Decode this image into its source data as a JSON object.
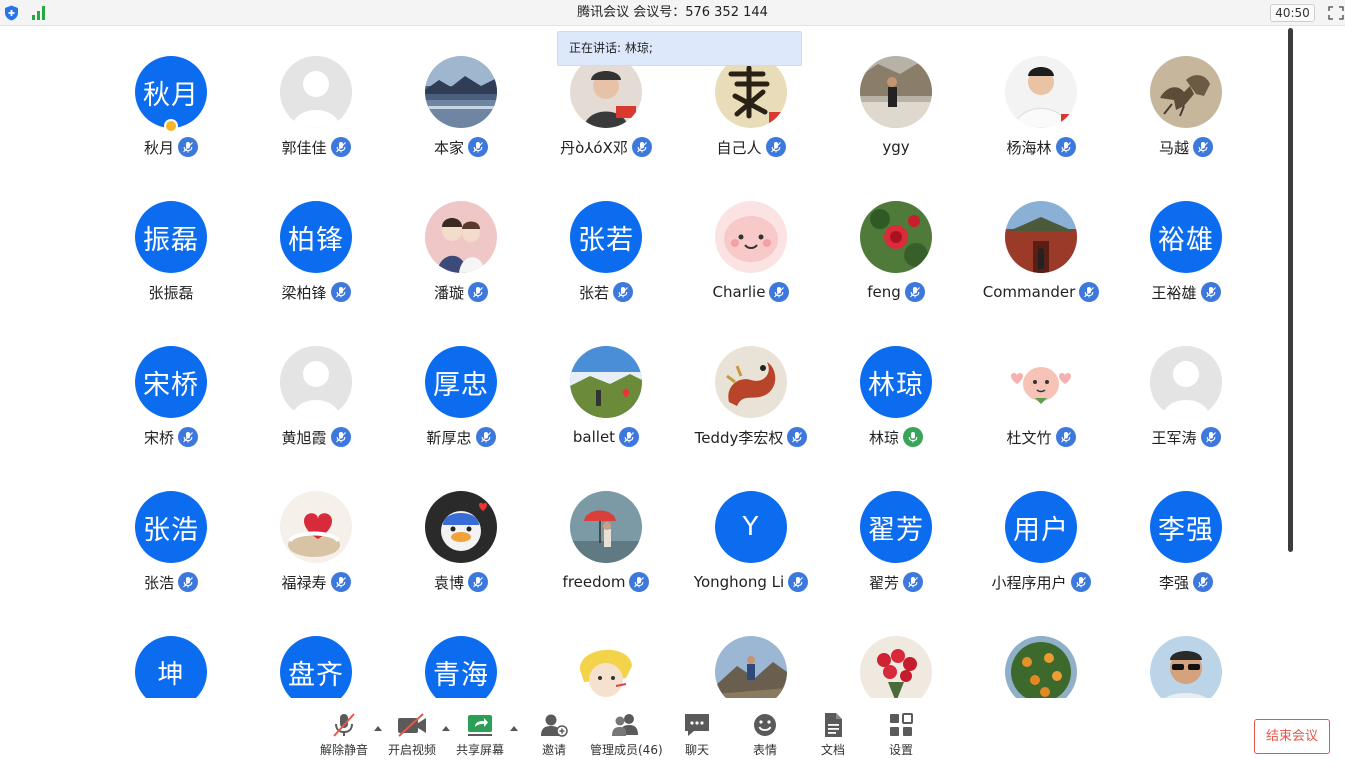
{
  "window": {
    "title": "腾讯会议 会议号：576 352 144",
    "timer": "40:50"
  },
  "speaking_banner": "正在讲话: 林琼;",
  "participants": [
    {
      "name": "秋月",
      "avatar_type": "text",
      "avatar_text": "秋月",
      "mic": "muted",
      "host": true
    },
    {
      "name": "郭佳佳",
      "avatar_type": "silhouette",
      "mic": "muted"
    },
    {
      "name": "本家",
      "avatar_type": "photo",
      "photo": "landscape-lake",
      "mic": "muted"
    },
    {
      "name": "丹ò⅄óX邓",
      "avatar_type": "photo",
      "photo": "person-cap",
      "mic": "muted"
    },
    {
      "name": "自己人",
      "avatar_type": "photo",
      "photo": "calligraphy",
      "mic": "muted"
    },
    {
      "name": "ygy",
      "avatar_type": "photo",
      "photo": "person-outdoor",
      "mic": "none"
    },
    {
      "name": "杨海林",
      "avatar_type": "photo",
      "photo": "person-portrait",
      "mic": "muted"
    },
    {
      "name": "马越",
      "avatar_type": "photo",
      "photo": "horses-painting",
      "mic": "muted"
    },
    {
      "name": "张振磊",
      "avatar_type": "text",
      "avatar_text": "振磊",
      "mic": "none"
    },
    {
      "name": "梁柏锋",
      "avatar_type": "text",
      "avatar_text": "柏锋",
      "mic": "muted"
    },
    {
      "name": "潘璇",
      "avatar_type": "photo",
      "photo": "cartoon-couple",
      "mic": "muted"
    },
    {
      "name": "张若",
      "avatar_type": "text",
      "avatar_text": "张若",
      "mic": "muted"
    },
    {
      "name": "Charlie",
      "avatar_type": "photo",
      "photo": "pink-cartoon",
      "mic": "muted"
    },
    {
      "name": "feng",
      "avatar_type": "photo",
      "photo": "red-flower",
      "mic": "muted"
    },
    {
      "name": "Commander",
      "avatar_type": "photo",
      "photo": "temple",
      "mic": "muted"
    },
    {
      "name": "王裕雄",
      "avatar_type": "text",
      "avatar_text": "裕雄",
      "mic": "muted"
    },
    {
      "name": "宋桥",
      "avatar_type": "text",
      "avatar_text": "宋桥",
      "mic": "muted"
    },
    {
      "name": "黄旭霞",
      "avatar_type": "silhouette",
      "mic": "muted"
    },
    {
      "name": "靳厚忠",
      "avatar_type": "text",
      "avatar_text": "厚忠",
      "mic": "muted"
    },
    {
      "name": "ballet",
      "avatar_type": "photo",
      "photo": "sky-field",
      "mic": "muted"
    },
    {
      "name": "Teddy李宏权",
      "avatar_type": "photo",
      "photo": "dragon",
      "mic": "muted"
    },
    {
      "name": "林琼",
      "avatar_type": "text",
      "avatar_text": "林琼",
      "mic": "speaking"
    },
    {
      "name": "杜文竹",
      "avatar_type": "photo",
      "photo": "peach-cartoon",
      "mic": "muted"
    },
    {
      "name": "王军涛",
      "avatar_type": "silhouette",
      "mic": "muted"
    },
    {
      "name": "张浩",
      "avatar_type": "text",
      "avatar_text": "张浩",
      "mic": "muted"
    },
    {
      "name": "福禄寿",
      "avatar_type": "photo",
      "photo": "cake-heart",
      "mic": "muted"
    },
    {
      "name": "袁博",
      "avatar_type": "photo",
      "photo": "duck-cartoon",
      "mic": "muted"
    },
    {
      "name": "freedom",
      "avatar_type": "photo",
      "photo": "umbrella-girl",
      "mic": "muted"
    },
    {
      "name": "Yonghong Li",
      "avatar_type": "text",
      "avatar_text": "Y",
      "mic": "muted"
    },
    {
      "name": "翟芳",
      "avatar_type": "text",
      "avatar_text": "翟芳",
      "mic": "muted"
    },
    {
      "name": "小程序用户",
      "avatar_type": "text",
      "avatar_text": "用户",
      "mic": "muted"
    },
    {
      "name": "李强",
      "avatar_type": "text",
      "avatar_text": "李强",
      "mic": "muted"
    },
    {
      "name": "",
      "avatar_type": "text",
      "avatar_text": "坤",
      "mic": "none"
    },
    {
      "name": "",
      "avatar_type": "text",
      "avatar_text": "盘齐",
      "mic": "none"
    },
    {
      "name": "",
      "avatar_type": "text",
      "avatar_text": "青海",
      "mic": "none"
    },
    {
      "name": "",
      "avatar_type": "photo",
      "photo": "blonde-cartoon",
      "mic": "none"
    },
    {
      "name": "",
      "avatar_type": "photo",
      "photo": "mountain-hiker",
      "mic": "none"
    },
    {
      "name": "",
      "avatar_type": "photo",
      "photo": "rose-bouquet",
      "mic": "none"
    },
    {
      "name": "",
      "avatar_type": "photo",
      "photo": "orange-tree",
      "mic": "none"
    },
    {
      "name": "",
      "avatar_type": "photo",
      "photo": "man-sunglasses",
      "mic": "none"
    }
  ],
  "toolbar": {
    "unmute": "解除静音",
    "start_video": "开启视频",
    "share_screen": "共享屏幕",
    "invite": "邀请",
    "manage_members": "管理成员(46)",
    "chat": "聊天",
    "reactions": "表情",
    "documents": "文档",
    "settings": "设置"
  },
  "end_meeting": "结束会议",
  "colors": {
    "accent_blue": "#0b6cf0",
    "mic_blue": "#3d78dc",
    "mic_speaking": "#3aa55a",
    "end_red": "#e5574d",
    "banner": "#dde9fb"
  }
}
